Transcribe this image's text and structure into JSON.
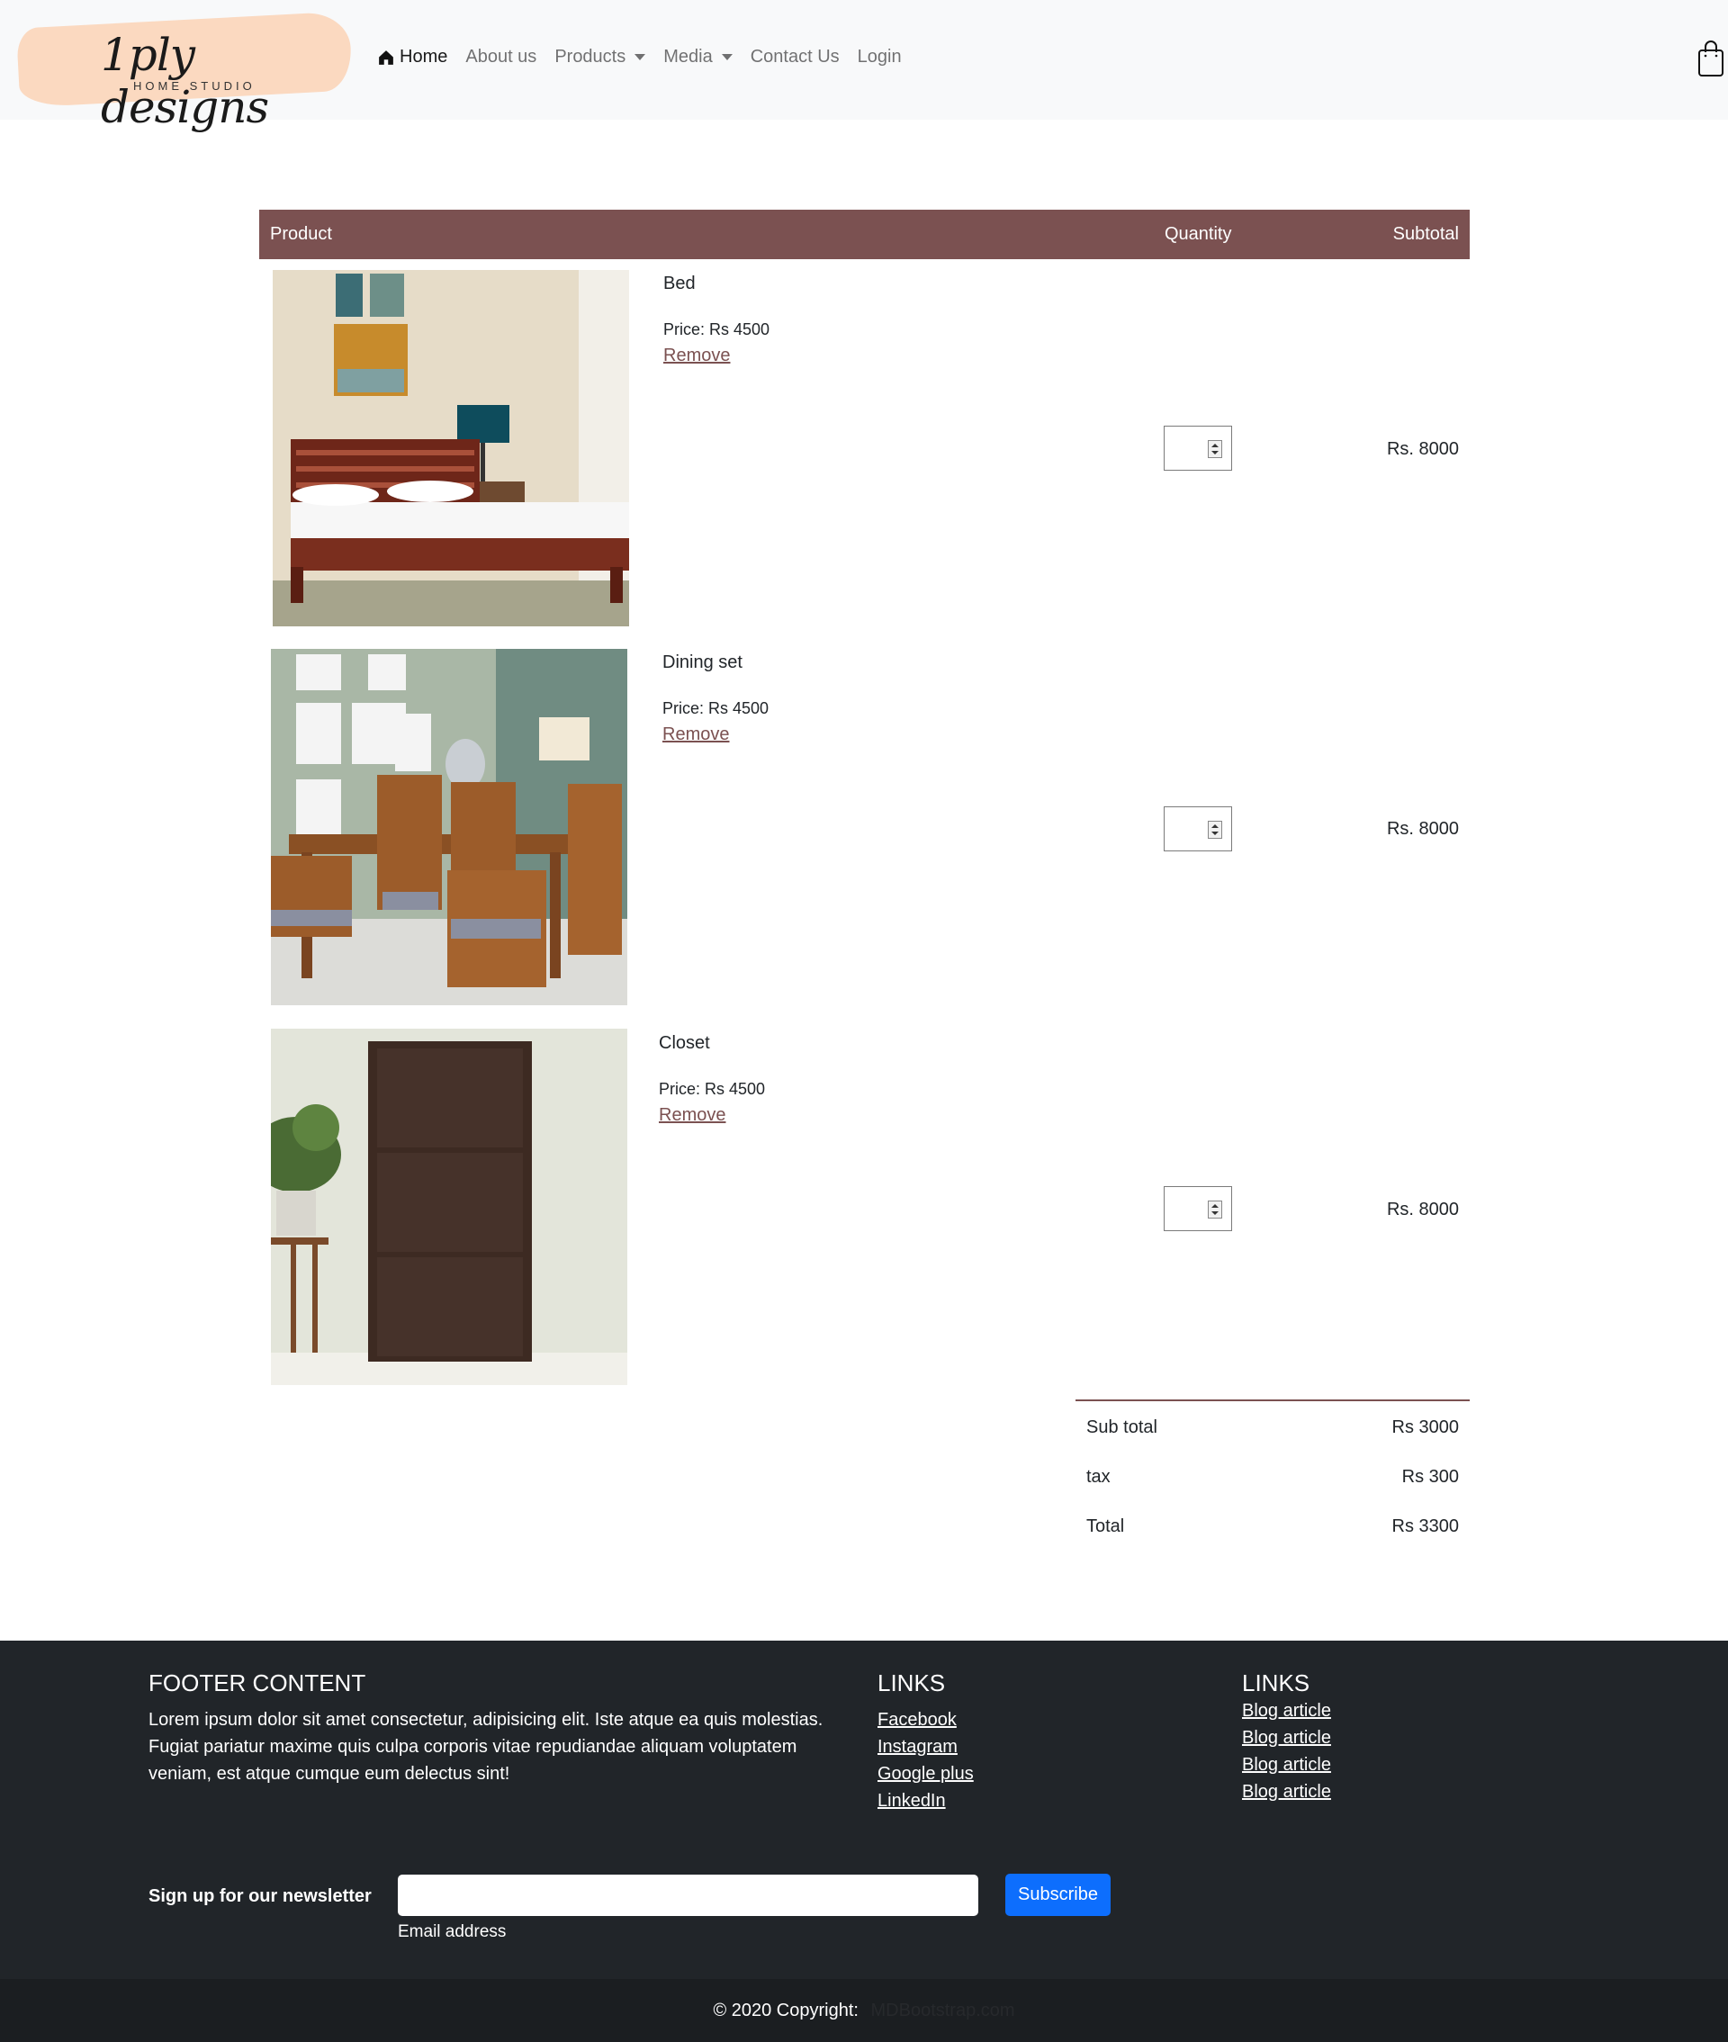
{
  "brand": {
    "name": "1ply designs",
    "tagline": "HOME STUDIO"
  },
  "nav": {
    "home": "Home",
    "about": "About us",
    "products": "Products",
    "media": "Media",
    "contact": "Contact Us",
    "login": "Login"
  },
  "cart_table": {
    "headers": {
      "product": "Product",
      "quantity": "Quantity",
      "subtotal": "Subtotal"
    },
    "items": [
      {
        "name": "Bed",
        "price": "Price: Rs 4500",
        "remove": "Remove",
        "subtotal": "Rs. 8000"
      },
      {
        "name": "Dining set",
        "price": "Price: Rs 4500",
        "remove": "Remove",
        "subtotal": "Rs. 8000"
      },
      {
        "name": "Closet",
        "price": "Price: Rs 4500",
        "remove": "Remove",
        "subtotal": "Rs. 8000"
      }
    ]
  },
  "totals": {
    "subtotal_label": "Sub total",
    "subtotal_value": "Rs 3000",
    "tax_label": "tax",
    "tax_value": "Rs 300",
    "total_label": "Total",
    "total_value": "Rs 3300"
  },
  "footer": {
    "content_title": "FOOTER CONTENT",
    "content_text": "Lorem ipsum dolor sit amet consectetur, adipisicing elit. Iste atque ea quis molestias. Fugiat pariatur maxime quis culpa corporis vitae repudiandae aliquam voluptatem veniam, est atque cumque eum delectus sint!",
    "links1_title": "LINKS",
    "links1": [
      "Facebook",
      "Instagram",
      "Google plus",
      "LinkedIn"
    ],
    "links2_title": "LINKS",
    "links2": [
      "Blog article",
      "Blog article",
      "Blog article",
      "Blog article"
    ],
    "newsletter_label": "Sign up for our newsletter",
    "email_caption": "Email address",
    "subscribe": "Subscribe",
    "copyright": "© 2020 Copyright:",
    "copyright_link": "MDBootstrap.com"
  },
  "colors": {
    "accent": "#7b5151",
    "footer": "#212529",
    "button": "#0d6efd"
  }
}
